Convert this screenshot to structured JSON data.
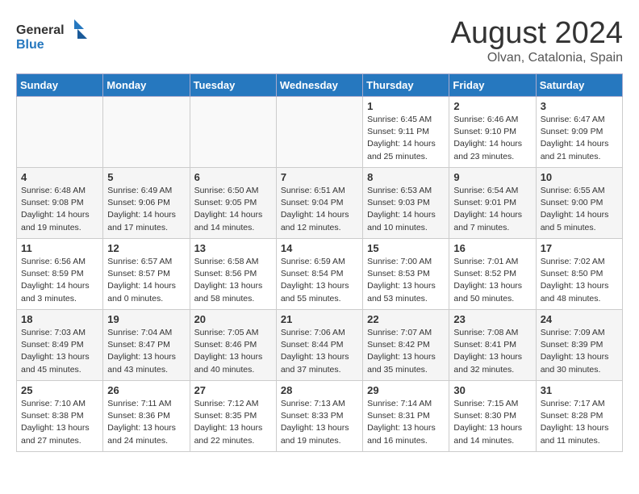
{
  "header": {
    "logo_line1": "General",
    "logo_line2": "Blue",
    "month_year": "August 2024",
    "location": "Olvan, Catalonia, Spain"
  },
  "weekdays": [
    "Sunday",
    "Monday",
    "Tuesday",
    "Wednesday",
    "Thursday",
    "Friday",
    "Saturday"
  ],
  "weeks": [
    [
      {
        "day": "",
        "info": ""
      },
      {
        "day": "",
        "info": ""
      },
      {
        "day": "",
        "info": ""
      },
      {
        "day": "",
        "info": ""
      },
      {
        "day": "1",
        "info": "Sunrise: 6:45 AM\nSunset: 9:11 PM\nDaylight: 14 hours\nand 25 minutes."
      },
      {
        "day": "2",
        "info": "Sunrise: 6:46 AM\nSunset: 9:10 PM\nDaylight: 14 hours\nand 23 minutes."
      },
      {
        "day": "3",
        "info": "Sunrise: 6:47 AM\nSunset: 9:09 PM\nDaylight: 14 hours\nand 21 minutes."
      }
    ],
    [
      {
        "day": "4",
        "info": "Sunrise: 6:48 AM\nSunset: 9:08 PM\nDaylight: 14 hours\nand 19 minutes."
      },
      {
        "day": "5",
        "info": "Sunrise: 6:49 AM\nSunset: 9:06 PM\nDaylight: 14 hours\nand 17 minutes."
      },
      {
        "day": "6",
        "info": "Sunrise: 6:50 AM\nSunset: 9:05 PM\nDaylight: 14 hours\nand 14 minutes."
      },
      {
        "day": "7",
        "info": "Sunrise: 6:51 AM\nSunset: 9:04 PM\nDaylight: 14 hours\nand 12 minutes."
      },
      {
        "day": "8",
        "info": "Sunrise: 6:53 AM\nSunset: 9:03 PM\nDaylight: 14 hours\nand 10 minutes."
      },
      {
        "day": "9",
        "info": "Sunrise: 6:54 AM\nSunset: 9:01 PM\nDaylight: 14 hours\nand 7 minutes."
      },
      {
        "day": "10",
        "info": "Sunrise: 6:55 AM\nSunset: 9:00 PM\nDaylight: 14 hours\nand 5 minutes."
      }
    ],
    [
      {
        "day": "11",
        "info": "Sunrise: 6:56 AM\nSunset: 8:59 PM\nDaylight: 14 hours\nand 3 minutes."
      },
      {
        "day": "12",
        "info": "Sunrise: 6:57 AM\nSunset: 8:57 PM\nDaylight: 14 hours\nand 0 minutes."
      },
      {
        "day": "13",
        "info": "Sunrise: 6:58 AM\nSunset: 8:56 PM\nDaylight: 13 hours\nand 58 minutes."
      },
      {
        "day": "14",
        "info": "Sunrise: 6:59 AM\nSunset: 8:54 PM\nDaylight: 13 hours\nand 55 minutes."
      },
      {
        "day": "15",
        "info": "Sunrise: 7:00 AM\nSunset: 8:53 PM\nDaylight: 13 hours\nand 53 minutes."
      },
      {
        "day": "16",
        "info": "Sunrise: 7:01 AM\nSunset: 8:52 PM\nDaylight: 13 hours\nand 50 minutes."
      },
      {
        "day": "17",
        "info": "Sunrise: 7:02 AM\nSunset: 8:50 PM\nDaylight: 13 hours\nand 48 minutes."
      }
    ],
    [
      {
        "day": "18",
        "info": "Sunrise: 7:03 AM\nSunset: 8:49 PM\nDaylight: 13 hours\nand 45 minutes."
      },
      {
        "day": "19",
        "info": "Sunrise: 7:04 AM\nSunset: 8:47 PM\nDaylight: 13 hours\nand 43 minutes."
      },
      {
        "day": "20",
        "info": "Sunrise: 7:05 AM\nSunset: 8:46 PM\nDaylight: 13 hours\nand 40 minutes."
      },
      {
        "day": "21",
        "info": "Sunrise: 7:06 AM\nSunset: 8:44 PM\nDaylight: 13 hours\nand 37 minutes."
      },
      {
        "day": "22",
        "info": "Sunrise: 7:07 AM\nSunset: 8:42 PM\nDaylight: 13 hours\nand 35 minutes."
      },
      {
        "day": "23",
        "info": "Sunrise: 7:08 AM\nSunset: 8:41 PM\nDaylight: 13 hours\nand 32 minutes."
      },
      {
        "day": "24",
        "info": "Sunrise: 7:09 AM\nSunset: 8:39 PM\nDaylight: 13 hours\nand 30 minutes."
      }
    ],
    [
      {
        "day": "25",
        "info": "Sunrise: 7:10 AM\nSunset: 8:38 PM\nDaylight: 13 hours\nand 27 minutes."
      },
      {
        "day": "26",
        "info": "Sunrise: 7:11 AM\nSunset: 8:36 PM\nDaylight: 13 hours\nand 24 minutes."
      },
      {
        "day": "27",
        "info": "Sunrise: 7:12 AM\nSunset: 8:35 PM\nDaylight: 13 hours\nand 22 minutes."
      },
      {
        "day": "28",
        "info": "Sunrise: 7:13 AM\nSunset: 8:33 PM\nDaylight: 13 hours\nand 19 minutes."
      },
      {
        "day": "29",
        "info": "Sunrise: 7:14 AM\nSunset: 8:31 PM\nDaylight: 13 hours\nand 16 minutes."
      },
      {
        "day": "30",
        "info": "Sunrise: 7:15 AM\nSunset: 8:30 PM\nDaylight: 13 hours\nand 14 minutes."
      },
      {
        "day": "31",
        "info": "Sunrise: 7:17 AM\nSunset: 8:28 PM\nDaylight: 13 hours\nand 11 minutes."
      }
    ]
  ]
}
